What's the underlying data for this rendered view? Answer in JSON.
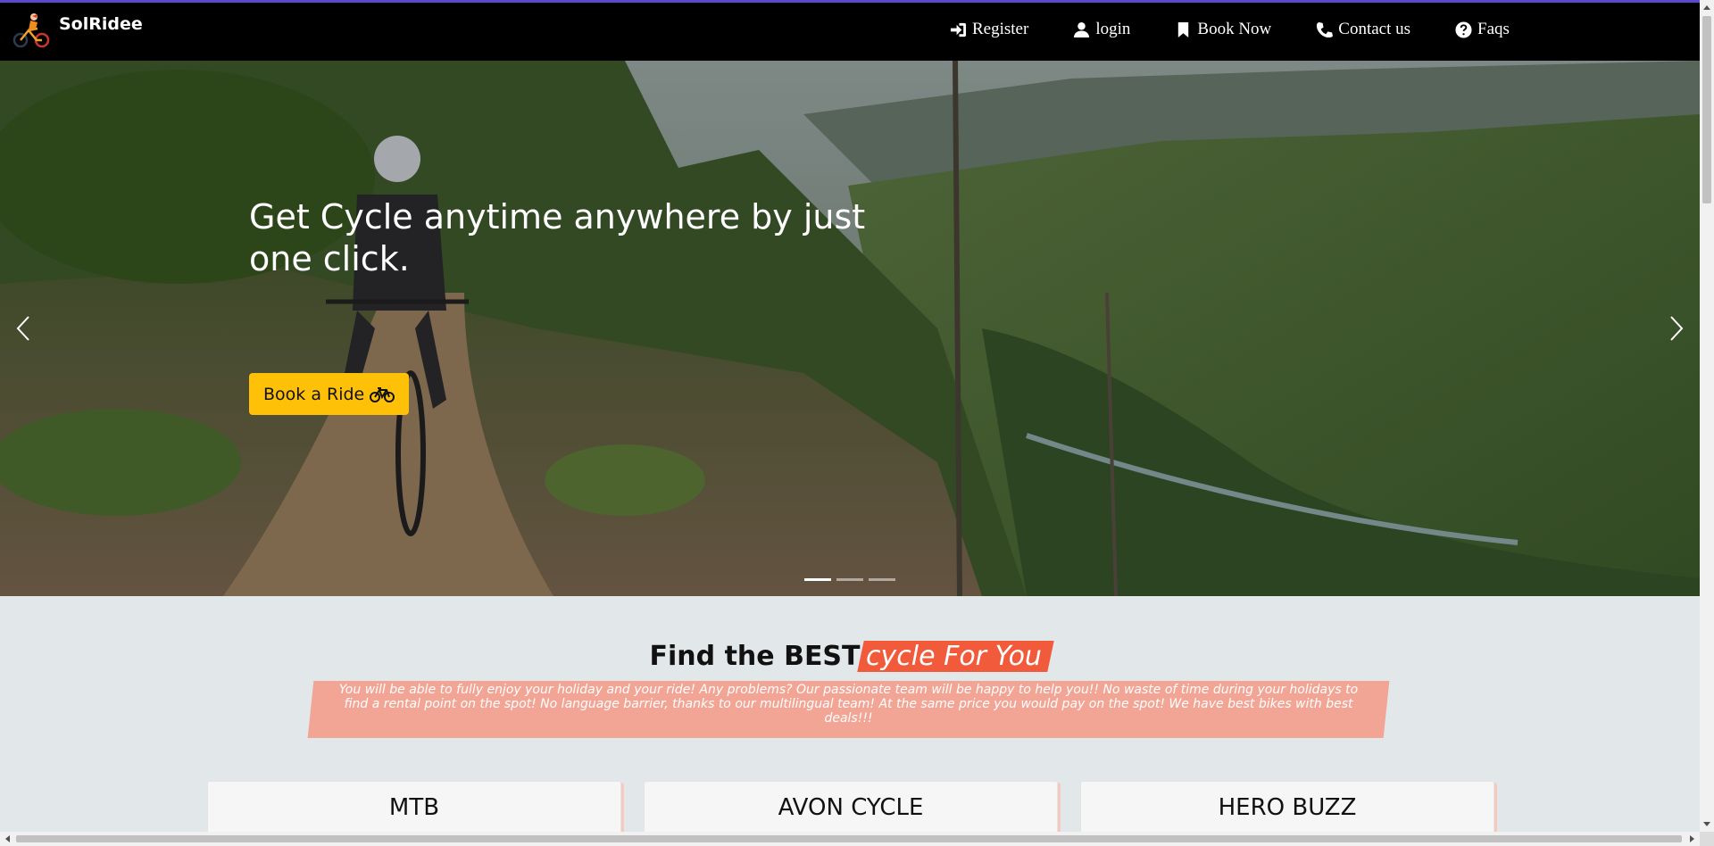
{
  "brand": {
    "name": "SolRidee"
  },
  "nav": {
    "register": "Register",
    "login": "login",
    "book_now": "Book Now",
    "contact": "Contact us",
    "faqs": "Faqs"
  },
  "hero": {
    "title": "Get Cycle anytime anywhere by just one click.",
    "button_label": "Book a Ride",
    "slides_count": 3,
    "active_slide": 1
  },
  "intro": {
    "title_plain": "Find the BEST",
    "title_highlight": "cycle For You",
    "text": "You will be able to fully enjoy your holiday and your ride! Any problems? Our passionate team will be happy to help you!! No waste of time during your holidays to find a rental point on the spot! No language barrier, thanks to our multilingual team! At the same price you would pay on the spot! We have best bikes with best deals!!!"
  },
  "cards": [
    {
      "title": "MTB"
    },
    {
      "title": "AVON CYCLE"
    },
    {
      "title": "HERO BUZZ"
    }
  ],
  "colors": {
    "navbar_bg": "#000000",
    "accent_line": "#5b4ad1",
    "hero_button": "#ffc107",
    "highlight": "#f15a3a",
    "intro_box": "#f2a595",
    "page_bg": "#e2e7ea"
  },
  "icons": {
    "register": "sign-in-icon",
    "login": "user-icon",
    "book_now": "bookmark-icon",
    "contact": "phone-icon",
    "faqs": "question-circle-icon",
    "hero_button": "bicycle-icon"
  }
}
